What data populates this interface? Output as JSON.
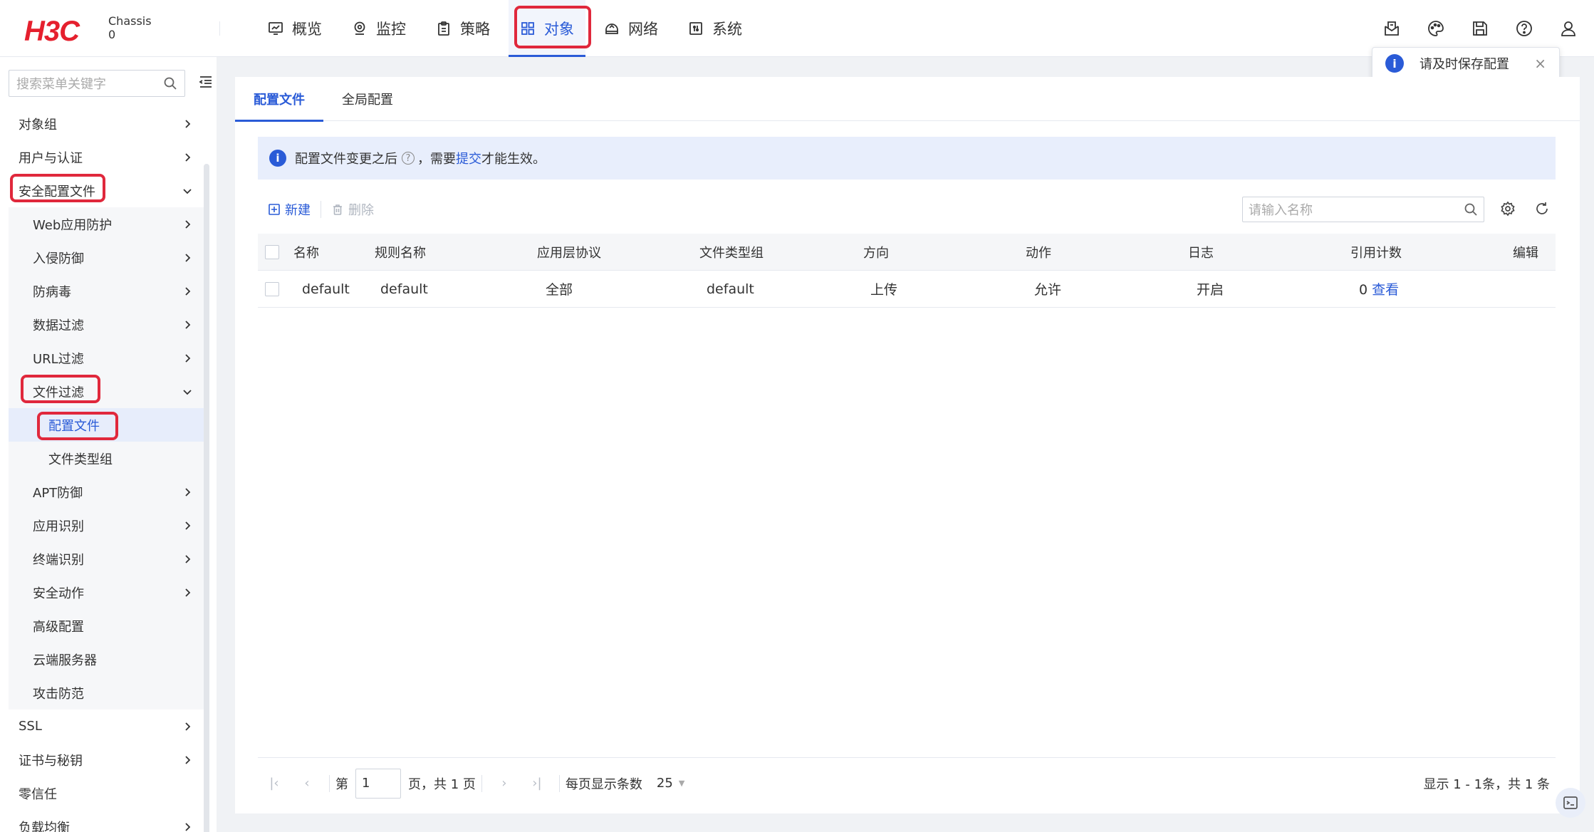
{
  "header": {
    "logo": "H3C",
    "chassis_line1": "Chassis",
    "chassis_line2": "0",
    "nav": [
      {
        "label": "概览",
        "icon": "dashboard-icon"
      },
      {
        "label": "监控",
        "icon": "location-pin-icon"
      },
      {
        "label": "策略",
        "icon": "clipboard-icon"
      },
      {
        "label": "对象",
        "icon": "grid-icon",
        "active": true
      },
      {
        "label": "网络",
        "icon": "network-icon"
      },
      {
        "label": "系统",
        "icon": "system-icon"
      }
    ],
    "right_icons": [
      "mail-icon",
      "palette-icon",
      "save-icon",
      "help-icon",
      "user-icon"
    ]
  },
  "toast": {
    "message": "请及时保存配置",
    "close": "×"
  },
  "sidebar": {
    "search_placeholder": "搜索菜单关键字",
    "items": [
      {
        "label": "对象组",
        "level": 0,
        "arrow": "right"
      },
      {
        "label": "用户与认证",
        "level": 0,
        "arrow": "right"
      },
      {
        "label": "安全配置文件",
        "level": 0,
        "arrow": "down"
      },
      {
        "label": "Web应用防护",
        "level": 1,
        "arrow": "right"
      },
      {
        "label": "入侵防御",
        "level": 1,
        "arrow": "right"
      },
      {
        "label": "防病毒",
        "level": 1,
        "arrow": "right"
      },
      {
        "label": "数据过滤",
        "level": 1,
        "arrow": "right"
      },
      {
        "label": "URL过滤",
        "level": 1,
        "arrow": "right"
      },
      {
        "label": "文件过滤",
        "level": 1,
        "arrow": "down"
      },
      {
        "label": "配置文件",
        "level": 2,
        "arrow": "",
        "selected": true
      },
      {
        "label": "文件类型组",
        "level": 2,
        "arrow": ""
      },
      {
        "label": "APT防御",
        "level": 1,
        "arrow": "right"
      },
      {
        "label": "应用识别",
        "level": 1,
        "arrow": "right"
      },
      {
        "label": "终端识别",
        "level": 1,
        "arrow": "right"
      },
      {
        "label": "安全动作",
        "level": 1,
        "arrow": "right"
      },
      {
        "label": "高级配置",
        "level": 1,
        "arrow": ""
      },
      {
        "label": "云端服务器",
        "level": 1,
        "arrow": ""
      },
      {
        "label": "攻击防范",
        "level": 1,
        "arrow": ""
      },
      {
        "label": "SSL",
        "level": 0,
        "arrow": "right"
      },
      {
        "label": "证书与秘钥",
        "level": 0,
        "arrow": "right"
      },
      {
        "label": "零信任",
        "level": 0,
        "arrow": ""
      },
      {
        "label": "负载均衡",
        "level": 0,
        "arrow": "right"
      }
    ]
  },
  "main": {
    "tabs": [
      {
        "label": "配置文件",
        "active": true
      },
      {
        "label": "全局配置",
        "active": false
      }
    ],
    "alert": {
      "text_before": "配置文件变更之后",
      "text_mid": "，需要",
      "link": "提交",
      "text_after": "才能生效。"
    },
    "toolbar": {
      "new_label": "新建",
      "delete_label": "删除",
      "search_placeholder": "请输入名称"
    },
    "table": {
      "columns": [
        "名称",
        "规则名称",
        "应用层协议",
        "文件类型组",
        "方向",
        "动作",
        "日志",
        "引用计数",
        "编辑"
      ],
      "rows": [
        {
          "name": "default",
          "rule": "default",
          "protocol": "全部",
          "filetype": "default",
          "direction": "上传",
          "action": "允许",
          "log": "开启",
          "ref_count": "0",
          "ref_link": "查看"
        }
      ]
    },
    "pager": {
      "page_prefix": "第",
      "page_value": "1",
      "page_suffix": "页，共 1 页",
      "size_label": "每页显示条数",
      "size_value": "25",
      "total": "显示 1 - 1条，共 1 条"
    }
  },
  "colors": {
    "accent": "#2a5bd7",
    "highlight_box": "#e0283c",
    "brand": "#e5202e"
  }
}
